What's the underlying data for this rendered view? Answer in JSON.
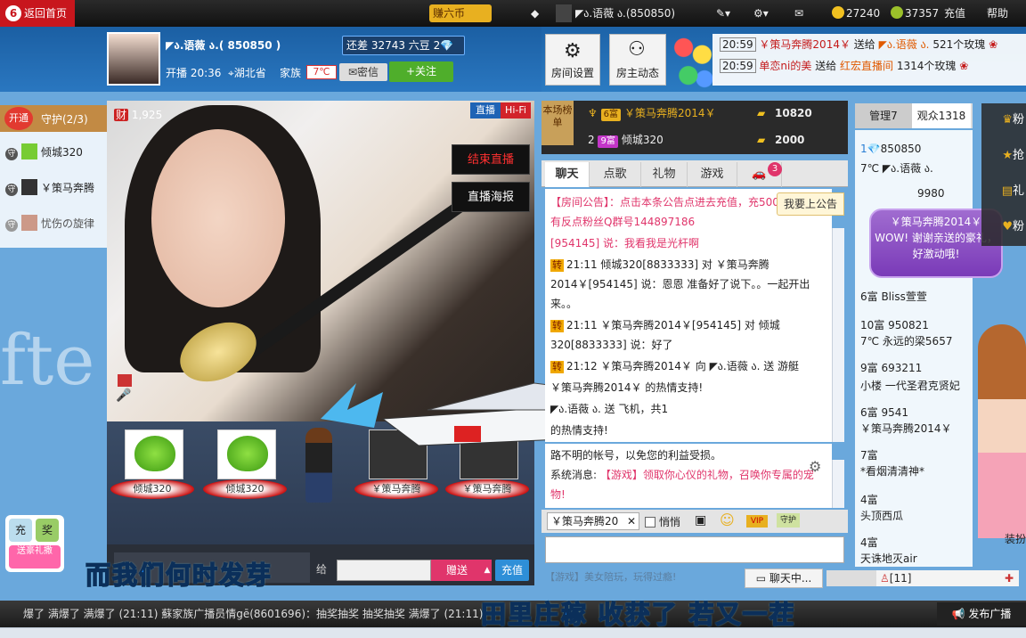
{
  "topbar": {
    "home": "返回首页",
    "earn": "赚六币",
    "username": "◤ა.语薇 ა.",
    "user_id": "(850850)",
    "coins": "27240",
    "beans": "37357",
    "recharge": "充值",
    "help": "帮助"
  },
  "anchor": {
    "name": "◤ა.语薇 ა.",
    "id": "( 850850 )",
    "diamond_text": "还差 32743 六豆",
    "diamond_count": "2",
    "live_time": "开播 20:36",
    "location": "湖北省",
    "family_label": "家族",
    "family_tag": "7℃",
    "message": "密信",
    "follow": "+关注"
  },
  "header_buttons": {
    "room_settings": "房间设置",
    "host_news": "房主动态"
  },
  "gift_feed": [
    {
      "time": "20:59",
      "user": "￥策马奔腾2014￥",
      "verb": "送给",
      "to": "◤ა.语薇 ა.",
      "gift": "521个玫瑰"
    },
    {
      "time": "20:59",
      "user": "单恋ni的美",
      "verb": "送给",
      "to": "红宏直播间",
      "gift": "1314个玫瑰"
    }
  ],
  "guard": {
    "open": "开通",
    "title": "守护(2/3)",
    "members": [
      "倾城320",
      "￥策马奔腾",
      "忧伤の旋律"
    ]
  },
  "video": {
    "viewer_count": "1,925",
    "live_tag": "直播",
    "hifi_tag": "Hi-Fi",
    "end_live": "结束直播",
    "poster": "直播海报"
  },
  "seats": [
    {
      "name": "倾城320"
    },
    {
      "name": "倾城320"
    },
    {
      "name": "￥策马奔腾"
    },
    {
      "name": "￥策马奔腾"
    }
  ],
  "gift_bar": {
    "say_to": "给",
    "send": "赠送",
    "recharge": "充值"
  },
  "captions": {
    "top": "而我们何时发芽",
    "bottom": "田里庄稼 收获了 若又一茬"
  },
  "ranking": {
    "badge": "本场榜单",
    "rows": [
      {
        "rank": "",
        "level": "6富",
        "name": "￥策马奔腾2014￥",
        "score": "10820"
      },
      {
        "rank": "2",
        "level": "9富",
        "name": "倾城320",
        "score": "2000"
      }
    ]
  },
  "tabs": [
    "聊天",
    "点歌",
    "礼物",
    "游戏"
  ],
  "car_badge": "3",
  "chat": {
    "notice_btn": "我要上公告",
    "lines": [
      "【房间公告】：点击本条公告点进去充值，充500送紫VIP有反点粉丝Q群号144897186",
      "[954145] 说：我看我是光杆啊",
      "21:11 倾城320[8833333] 对 ￥策马奔腾2014￥[954145] 说：恩恩 准备好了说下。。一起开出来。。",
      "21:11 ￥策马奔腾2014￥[954145] 对 倾城320[8833333] 说：好了",
      "21:12 ￥策马奔腾2014￥ 向 ◤ა.语薇 ა. 送 游艇",
      "￥策马奔腾2014￥ 的热情支持!",
      "◤ა.语薇 ა. 送 飞机，共1",
      "的热情支持!"
    ],
    "sys1": "路不明的帐号，以免您的利益受损。",
    "sys_label": "系统消息:",
    "sys2": "【游戏】领取你心仪的礼物，召唤你专属的宠物!"
  },
  "input": {
    "target": "￥策马奔腾20",
    "whisper": "悄悄",
    "game_ad": "【游戏】美女陪玩，玩得过瘾!",
    "chatting": "聊天中...",
    "user_count": "[11]"
  },
  "audience": {
    "manage": "管理7",
    "viewers": "观众1318",
    "rows": [
      "850850",
      "7℃ ◤ა.语薇 ა.",
      "9980",
      "￥策马奔腾2014￥",
      "6富 Bliss萱萱",
      "10富 950821",
      "7℃ 永远的梁5657",
      "9富 693211",
      "小楼 一代圣君克贤妃",
      "6富 9541",
      "￥策马奔腾2014￥",
      "7富",
      "*看烟清清神*",
      "4富",
      "头顶西瓜",
      "4富",
      "天诛地灭air"
    ],
    "bubble_name": "￥策马奔腾2014￥",
    "bubble_text": "WOW! 谢谢亲送的豪礼，好激动哦!"
  },
  "sidebar": {
    "items": [
      "粉",
      "抢",
      "礼",
      "粉"
    ],
    "decorate": "装扮"
  },
  "left_badges": {
    "charge": "充",
    "reward": "奖",
    "gift": "送豪礼撒"
  },
  "ticker": {
    "text": "爆了 满爆了 满爆了 (21:11) 蘇家族广播员情gē(8601696)：抽奖抽奖 抽奖抽奖 满爆了 (21:11)",
    "broadcast": "发布广播"
  },
  "colors": {
    "brand_red": "#c8161d",
    "follow_green": "#4fae2b",
    "gift_pink": "#e0356b",
    "header_blue": "#1b5fa3"
  }
}
